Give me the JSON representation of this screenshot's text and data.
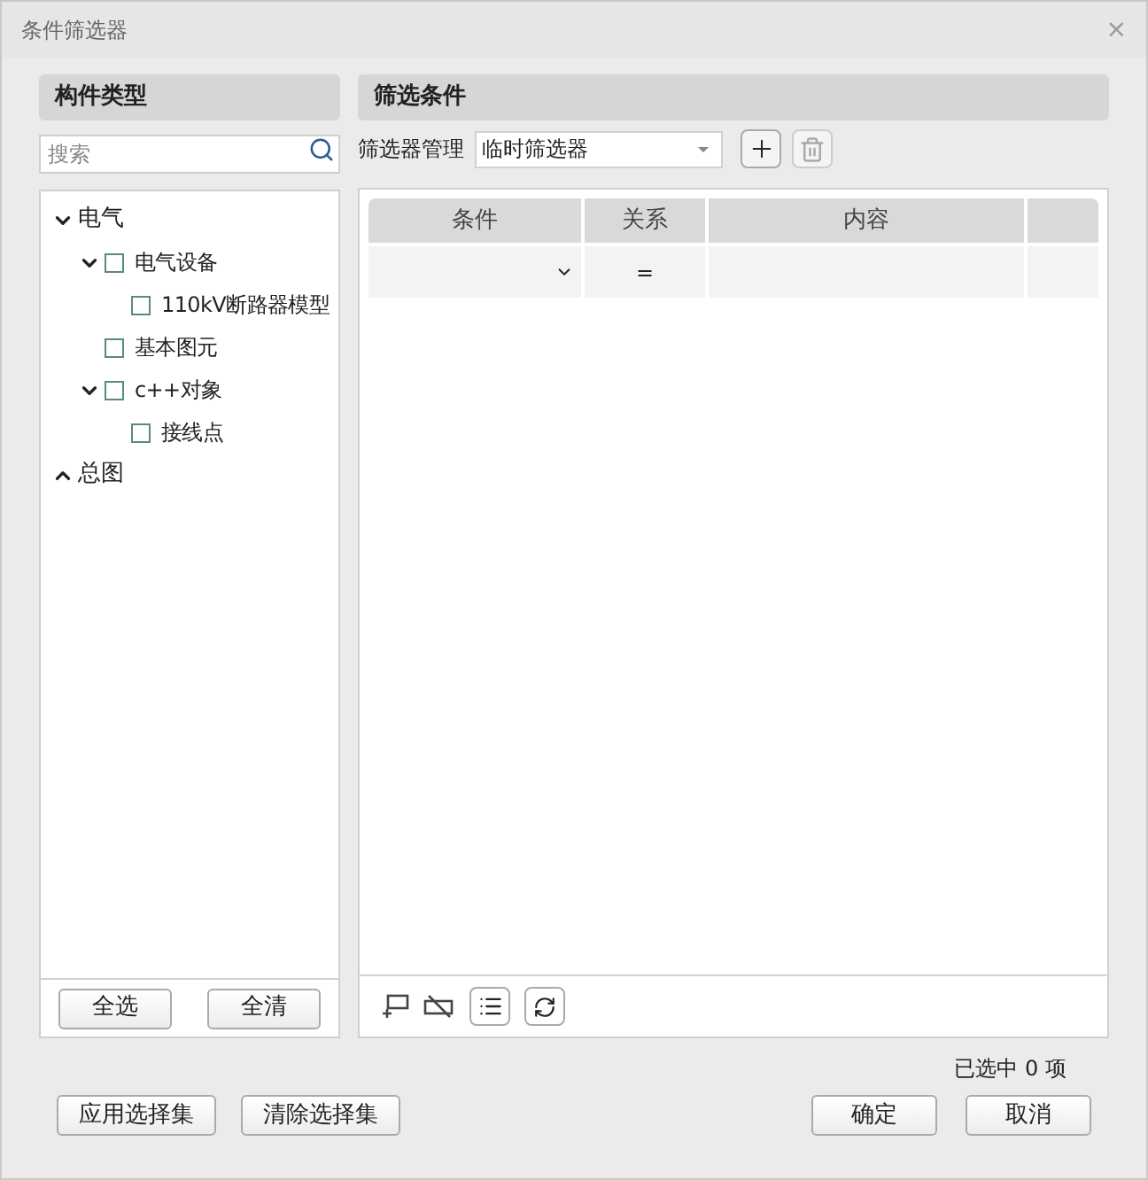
{
  "window": {
    "title": "条件筛选器",
    "close": "×"
  },
  "left_panel": {
    "title": "构件类型",
    "search": {
      "placeholder": "搜索"
    },
    "tree": [
      {
        "label": "电气",
        "kind": "category",
        "expanded": true,
        "children": [
          {
            "label": "电气设备",
            "kind": "type",
            "checked": false,
            "expanded": true,
            "children": [
              {
                "label": "110kV断路器模型",
                "kind": "type",
                "checked": false
              }
            ]
          },
          {
            "label": "基本图元",
            "kind": "type",
            "checked": false
          },
          {
            "label": "c++对象",
            "kind": "type",
            "checked": false,
            "expanded": true,
            "children": [
              {
                "label": "接线点",
                "kind": "type",
                "checked": false
              }
            ]
          }
        ]
      },
      {
        "label": "总图",
        "kind": "category",
        "expanded": false
      }
    ],
    "buttons": [
      "全选",
      "全清"
    ]
  },
  "right_panel": {
    "title": "筛选条件",
    "manager_label": "筛选器管理",
    "filter_select": {
      "value": "临时筛选器"
    },
    "table": {
      "columns": [
        "条件",
        "关系",
        "内容"
      ],
      "rows": [
        {
          "relation": "="
        }
      ]
    }
  },
  "selected_count": "已选中 0 项",
  "footer_left": [
    "应用选择集",
    "清除选择集"
  ],
  "footer_right": [
    "确定",
    "取消"
  ]
}
